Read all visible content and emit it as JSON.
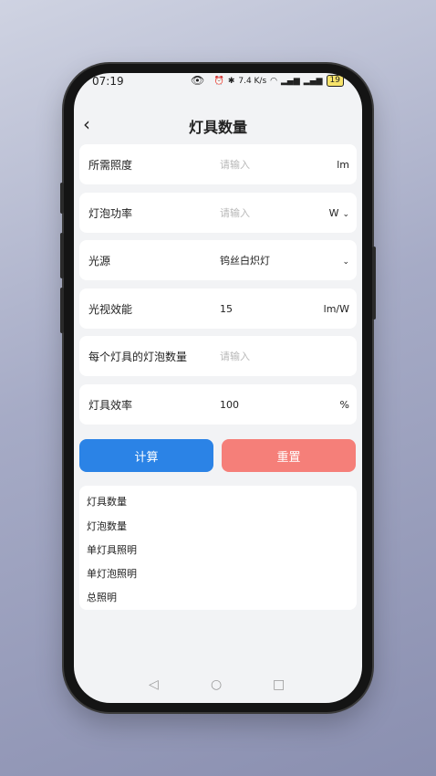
{
  "status": {
    "time": "07:19",
    "net_speed": "7.4 K/s",
    "battery": "19"
  },
  "nav": {
    "title": "灯具数量"
  },
  "rows": [
    {
      "label": "所需照度",
      "placeholder": "请输入",
      "value": "",
      "unit": "lm",
      "dropdown": false
    },
    {
      "label": "灯泡功率",
      "placeholder": "请输入",
      "value": "",
      "unit": "W",
      "dropdown": true
    },
    {
      "label": "光源",
      "placeholder": "",
      "value": "钨丝白炽灯",
      "unit": "",
      "dropdown": true
    },
    {
      "label": "光视效能",
      "placeholder": "",
      "value": "15",
      "unit": "lm/W",
      "dropdown": false
    },
    {
      "label": "每个灯具的灯泡数量",
      "placeholder": "请输入",
      "value": "",
      "unit": "",
      "dropdown": false
    },
    {
      "label": "灯具效率",
      "placeholder": "",
      "value": "100",
      "unit": "%",
      "dropdown": false
    }
  ],
  "buttons": {
    "calculate": "计算",
    "reset": "重置"
  },
  "results": [
    "灯具数量",
    "灯泡数量",
    "单灯具照明",
    "单灯泡照明",
    "总照明"
  ],
  "colors": {
    "primary": "#2b83e6",
    "danger": "#f57f79",
    "background": "#f2f3f5"
  }
}
